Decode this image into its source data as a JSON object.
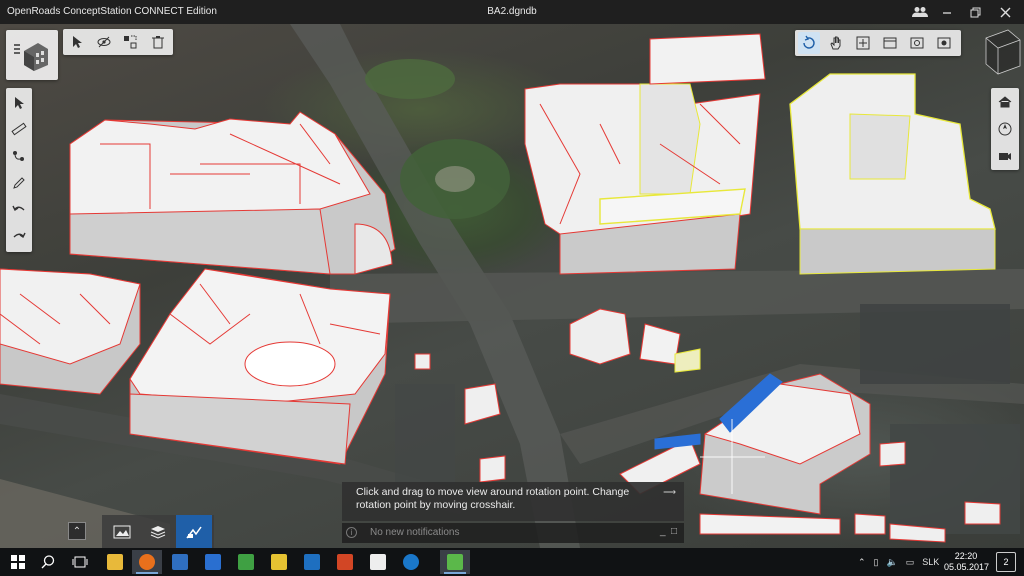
{
  "window": {
    "app_title": "OpenRoads ConceptStation CONNECT Edition",
    "document_title": "BA2.dgndb",
    "controls": [
      "user-group-icon",
      "minimize-icon",
      "restore-icon",
      "close-icon"
    ]
  },
  "toolbars": {
    "top_left": [
      "select-icon",
      "hide-icon",
      "isolate-icon",
      "delete-icon"
    ],
    "top_right": [
      "rotate-view-icon",
      "pan-icon",
      "zoom-extents-icon",
      "window-area-icon",
      "camera-view-icon",
      "camera-settings-icon"
    ],
    "left": [
      "cursor-icon",
      "measure-icon",
      "sketch-road-icon",
      "draw-icon",
      "undo-icon",
      "redo-icon"
    ],
    "right": [
      "home-view-icon",
      "navigation-cube-icon",
      "video-camera-icon"
    ]
  },
  "notification": {
    "message": "Click and drag to move view around rotation point. Change rotation point by moving crosshair.",
    "status": "No new notifications"
  },
  "workflow_tabs": [
    "map-tab",
    "layers-tab",
    "design-tab"
  ],
  "taskbar": {
    "apps": [
      "start",
      "search",
      "task-view",
      "file-explorer",
      "firefox",
      "save",
      "calculator",
      "excel-like",
      "paint",
      "outlook",
      "powerpoint",
      "clapperboard",
      "teamviewer",
      "conceptstation"
    ],
    "language": "SLK",
    "time": "22:20",
    "date": "05.05.2017",
    "notification_count": "2"
  },
  "colors": {
    "building_edge": "#e53935",
    "selected_edge": "#e8e83a",
    "taskbar": "#101214",
    "active_tab": "#1f5fa8"
  }
}
